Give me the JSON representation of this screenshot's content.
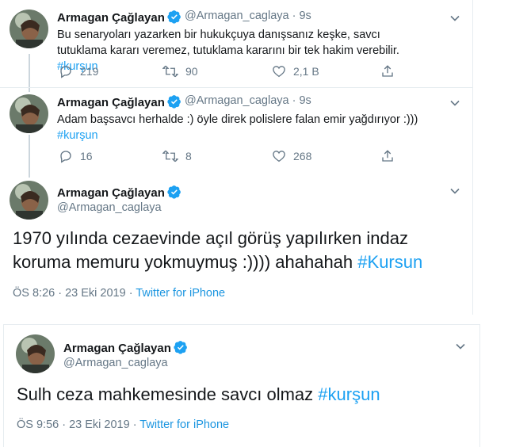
{
  "accent": "#1da1f2",
  "thread_tweets": [
    {
      "name": "Armagan Çağlayan",
      "handle": "@Armagan_caglaya · 9s",
      "text": "Bu senaryoları yazarken bir hukukçuya danışsanız keşke, savcı tutuklama kararı veremez, tutuklama kararını bir tek hakim verebilir.",
      "hashtag": "#kurşun",
      "replies": "219",
      "retweets": "90",
      "likes": "2,1 B"
    },
    {
      "name": "Armagan Çağlayan",
      "handle": "@Armagan_caglaya · 9s",
      "text": "Adam başsavcı herhalde :) öyle direk polislere falan emir yağdırıyor :)))",
      "hashtag": "#kurşun",
      "replies": "16",
      "retweets": "8",
      "likes": "268"
    }
  ],
  "focused_tweet_1": {
    "name": "Armagan Çağlayan",
    "handle": "@Armagan_caglaya",
    "text": "1970 yılında cezaevinde açıl görüş yapılırken indaz koruma memuru yokmuymuş :)))) ahahahah",
    "hashtag": "#Kursun",
    "time": "ÖS 8:26 · 23 Eki 2019 · ",
    "source": "Twitter for iPhone"
  },
  "focused_tweet_2": {
    "name": "Armagan Çağlayan",
    "handle": "@Armagan_caglaya",
    "text": "Sulh ceza mahkemesinde savcı olmaz",
    "hashtag": "#kurşun",
    "time": "ÖS 9:56 · 23 Eki 2019 · ",
    "source": "Twitter for iPhone"
  }
}
